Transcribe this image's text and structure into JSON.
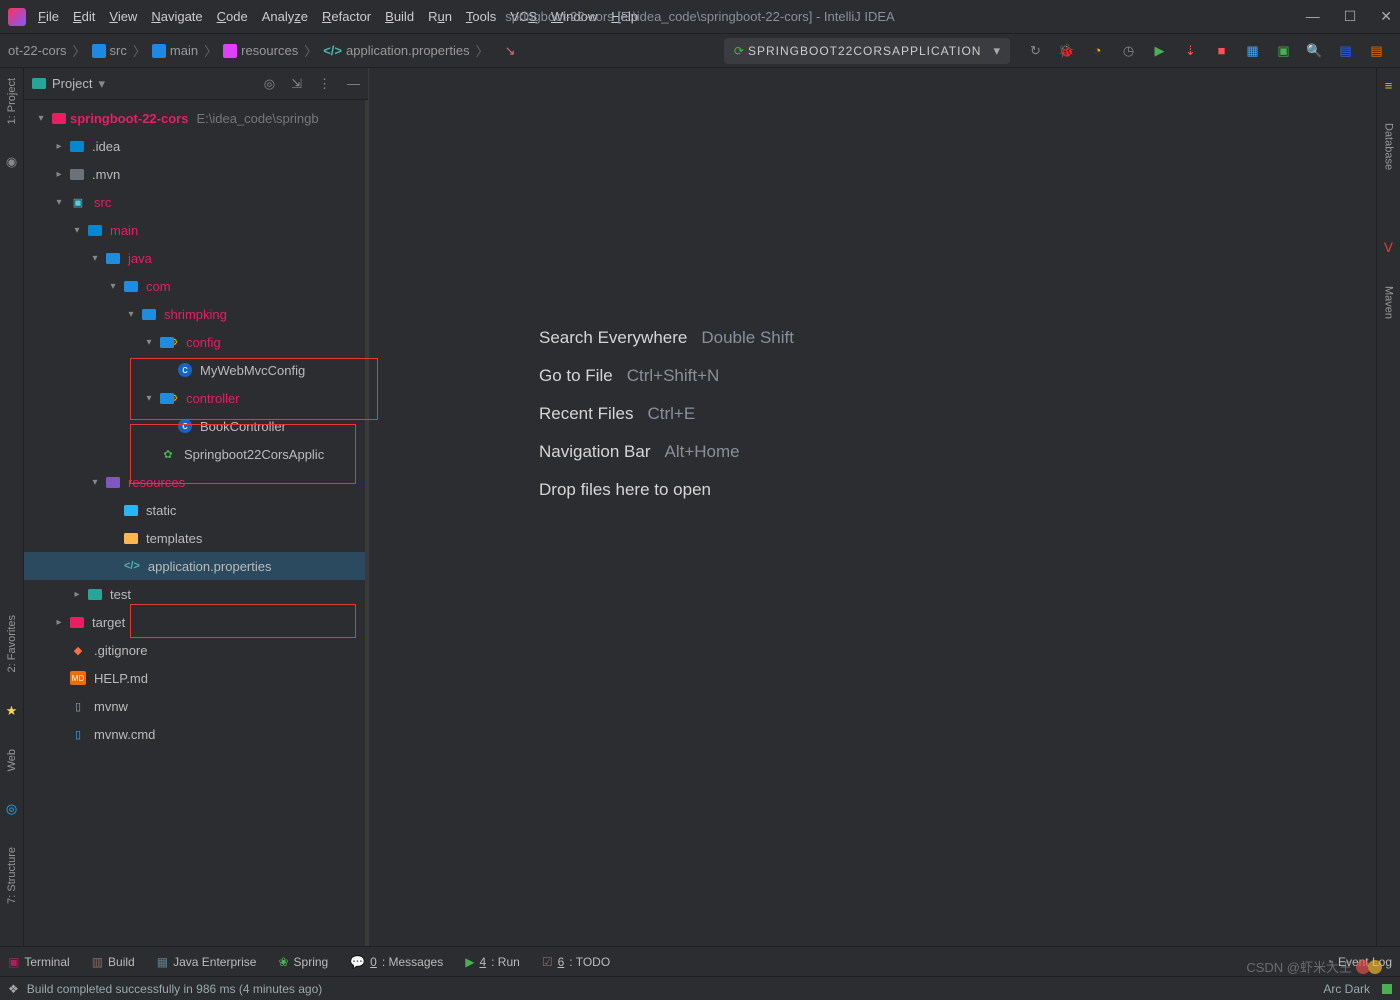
{
  "title_bar": {
    "app_title": "springboot-22-cors [E:\\idea_code\\springboot-22-cors] - IntelliJ IDEA",
    "menu": [
      "File",
      "Edit",
      "View",
      "Navigate",
      "Code",
      "Analyze",
      "Refactor",
      "Build",
      "Run",
      "Tools",
      "VCS",
      "Window",
      "Help"
    ]
  },
  "toolbar": {
    "breadcrumb": [
      "ot-22-cors",
      "src",
      "main",
      "resources",
      "application.properties"
    ],
    "run_config": "SPRINGBOOT22CORSAPPLICATION"
  },
  "sidebar": {
    "title": "Project",
    "root": "springboot-22-cors",
    "root_path": "E:\\idea_code\\springb",
    "items": [
      {
        "depth": 1,
        "label": ".idea",
        "icon": "folder-cyan",
        "arrow": ">"
      },
      {
        "depth": 1,
        "label": ".mvn",
        "icon": "folder-grey",
        "arrow": ">"
      },
      {
        "depth": 1,
        "label": "src",
        "icon": "module-cyan",
        "arrow": "v",
        "pink": true
      },
      {
        "depth": 2,
        "label": "main",
        "icon": "folder-cyan",
        "arrow": "v",
        "pink": true
      },
      {
        "depth": 3,
        "label": "java",
        "icon": "folder-blue",
        "arrow": "v",
        "pink": true
      },
      {
        "depth": 4,
        "label": "com",
        "icon": "folder-blue",
        "arrow": "v",
        "pink": true
      },
      {
        "depth": 5,
        "label": "shrimpking",
        "icon": "folder-blue",
        "arrow": "v",
        "pink": true
      },
      {
        "depth": 6,
        "label": "config",
        "icon": "folder-gear",
        "arrow": "v",
        "pink": true,
        "hl": 1
      },
      {
        "depth": 7,
        "label": "MyWebMvcConfig",
        "icon": "class",
        "arrow": "",
        "hl": 1
      },
      {
        "depth": 6,
        "label": "controller",
        "icon": "folder-gear",
        "arrow": "v",
        "pink": true,
        "hl": 2
      },
      {
        "depth": 7,
        "label": "BookController",
        "icon": "class",
        "arrow": "",
        "hl": 2
      },
      {
        "depth": 6,
        "label": "Springboot22CorsApplic",
        "icon": "spring",
        "arrow": ""
      },
      {
        "depth": 3,
        "label": "resources",
        "icon": "folder-resources",
        "arrow": "v",
        "pink": true
      },
      {
        "depth": 4,
        "label": "static",
        "icon": "folder-cyan-i",
        "arrow": ""
      },
      {
        "depth": 4,
        "label": "templates",
        "icon": "folder-orange",
        "arrow": ""
      },
      {
        "depth": 4,
        "label": "application.properties",
        "icon": "props",
        "arrow": "",
        "sel": true,
        "hl": 3
      },
      {
        "depth": 2,
        "label": "test",
        "icon": "folder-teal",
        "arrow": ">"
      },
      {
        "depth": 1,
        "label": "target",
        "icon": "folder-pink",
        "arrow": ">"
      },
      {
        "depth": 1,
        "label": ".gitignore",
        "icon": "git",
        "arrow": ""
      },
      {
        "depth": 1,
        "label": "HELP.md",
        "icon": "md",
        "arrow": ""
      },
      {
        "depth": 1,
        "label": "mvnw",
        "icon": "file",
        "arrow": ""
      },
      {
        "depth": 1,
        "label": "mvnw.cmd",
        "icon": "cmd",
        "arrow": ""
      }
    ]
  },
  "left_rail": [
    "1: Project",
    "2: Favorites",
    "Web",
    "7: Structure"
  ],
  "right_rail": [
    "Database",
    "Maven"
  ],
  "editor_hints": [
    {
      "label": "Search Everywhere",
      "key": "Double Shift"
    },
    {
      "label": "Go to File",
      "key": "Ctrl+Shift+N"
    },
    {
      "label": "Recent Files",
      "key": "Ctrl+E"
    },
    {
      "label": "Navigation Bar",
      "key": "Alt+Home"
    },
    {
      "label": "Drop files here to open",
      "key": ""
    }
  ],
  "bottom_tools": [
    "Terminal",
    "Build",
    "Java Enterprise",
    "Spring",
    "0: Messages",
    "4: Run",
    "6: TODO"
  ],
  "bottom_right": "Event Log",
  "status": {
    "msg": "Build completed successfully in 986 ms (4 minutes ago)",
    "right": "Arc Dark"
  },
  "watermark": "CSDN @虾米大王"
}
